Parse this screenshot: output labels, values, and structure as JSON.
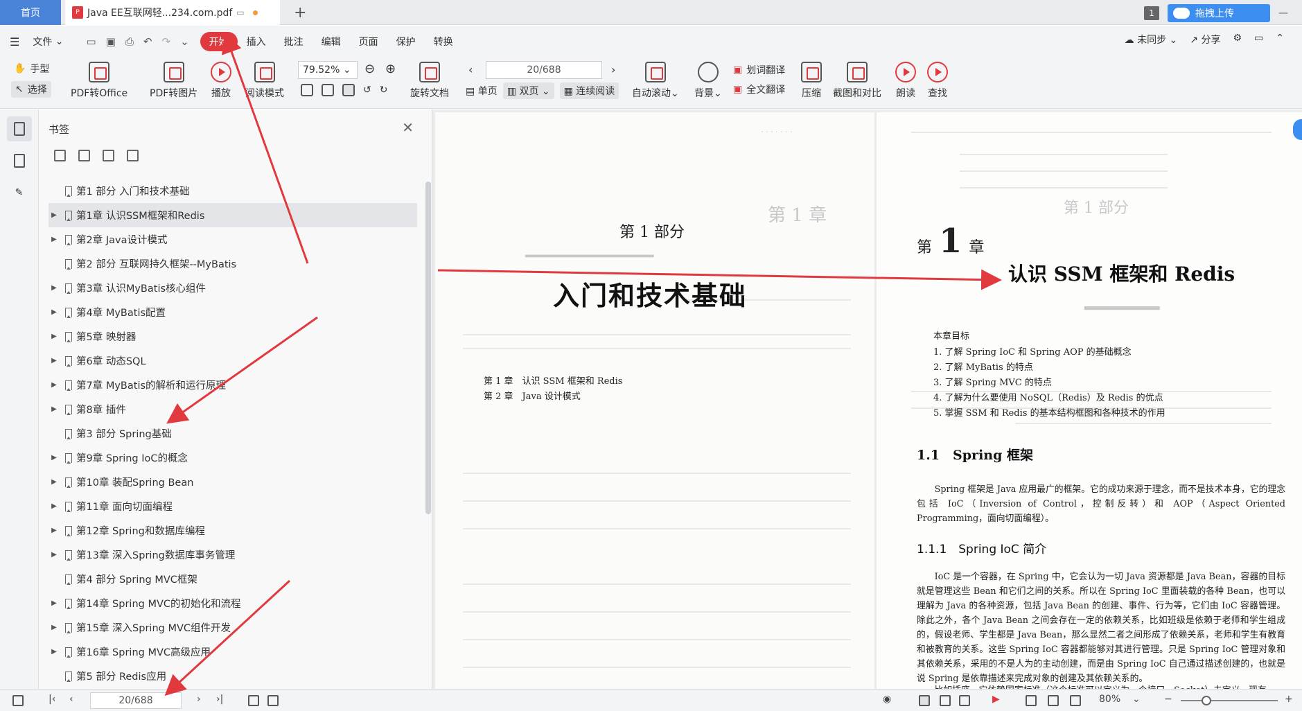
{
  "tabs": {
    "home": "首页",
    "document": "Java EE互联网轻...234.com.pdf",
    "badge": "1",
    "upload": "拖拽上传"
  },
  "menu": {
    "file": "文件",
    "items": [
      "开始",
      "插入",
      "批注",
      "编辑",
      "页面",
      "保护",
      "转换"
    ],
    "right": [
      "未同步",
      "分享"
    ]
  },
  "toolbar": {
    "hand": "手型",
    "select": "选择",
    "pdf_to_office": "PDF转Office",
    "pdf_to_image": "PDF转图片",
    "play": "播放",
    "read_mode": "阅读模式",
    "zoom": "79.52%",
    "page": "20/688",
    "rotate": "旋转文档",
    "single": "单页",
    "double": "双页",
    "continuous": "连续阅读",
    "autoscroll": "自动滚动",
    "background": "背景",
    "word_translate": "划词翻译",
    "full_translate": "全文翻译",
    "compress": "压缩",
    "screenshot": "截图和对比",
    "read_aloud": "朗读",
    "search": "查找"
  },
  "panel": {
    "title": "书签",
    "items": [
      {
        "label": "第1 部分 入门和技术基础",
        "arrow": false,
        "selected": false
      },
      {
        "label": "第1章 认识SSM框架和Redis",
        "arrow": true,
        "selected": true
      },
      {
        "label": "第2章 Java设计模式",
        "arrow": true,
        "selected": false
      },
      {
        "label": "第2 部分 互联网持久框架--MyBatis",
        "arrow": false,
        "selected": false
      },
      {
        "label": "第3章 认识MyBatis核心组件",
        "arrow": true,
        "selected": false
      },
      {
        "label": "第4章 MyBatis配置",
        "arrow": true,
        "selected": false
      },
      {
        "label": "第5章 映射器",
        "arrow": true,
        "selected": false
      },
      {
        "label": "第6章 动态SQL",
        "arrow": true,
        "selected": false
      },
      {
        "label": "第7章 MyBatis的解析和运行原理",
        "arrow": true,
        "selected": false
      },
      {
        "label": "第8章 插件",
        "arrow": true,
        "selected": false
      },
      {
        "label": "第3 部分 Spring基础",
        "arrow": false,
        "selected": false
      },
      {
        "label": "第9章 Spring IoC的概念",
        "arrow": true,
        "selected": false
      },
      {
        "label": "第10章 装配Spring Bean",
        "arrow": true,
        "selected": false
      },
      {
        "label": "第11章 面向切面编程",
        "arrow": true,
        "selected": false
      },
      {
        "label": "第12章 Spring和数据库编程",
        "arrow": true,
        "selected": false
      },
      {
        "label": "第13章 深入Spring数据库事务管理",
        "arrow": true,
        "selected": false
      },
      {
        "label": "第4 部分 Spring MVC框架",
        "arrow": false,
        "selected": false
      },
      {
        "label": "第14章 Spring MVC的初始化和流程",
        "arrow": true,
        "selected": false
      },
      {
        "label": "第15章 深入Spring MVC组件开发",
        "arrow": true,
        "selected": false
      },
      {
        "label": "第16章 Spring MVC高级应用",
        "arrow": true,
        "selected": false
      },
      {
        "label": "第5 部分 Redis应用",
        "arrow": false,
        "selected": false
      }
    ]
  },
  "left_page": {
    "part": "第 1 部分",
    "title": "入门和技术基础",
    "toc": [
      "第 1 章　认识 SSM 框架和 Redis",
      "第 2 章　Java 设计模式"
    ]
  },
  "right_page": {
    "chapter_prefix": "第",
    "chapter_number": "1",
    "chapter_suffix": "章",
    "title": "认识 SSM 框架和 Redis",
    "goal_heading": "本章目标",
    "goals": [
      "1. 了解 Spring IoC 和 Spring AOP 的基础概念",
      "2. 了解 MyBatis 的特点",
      "3. 了解 Spring MVC 的特点",
      "4. 了解为什么要使用 NoSQL（Redis）及 Redis 的优点",
      "5. 掌握 SSM 和 Redis 的基本结构框图和各种技术的作用"
    ],
    "section1": "1.1　Spring 框架",
    "para1": "Spring 框架是 Java 应用最广的框架。它的成功来源于理念，而不是技术本身，它的理念包括 IoC（Inversion of Control，控制反转）和 AOP（Aspect Oriented Programming，面向切面编程）。",
    "section2": "1.1.1　Spring IoC 简介",
    "para2": "IoC 是一个容器，在 Spring 中，它会认为一切 Java 资源都是 Java Bean，容器的目标就是管理这些 Bean 和它们之间的关系。所以在 Spring IoC 里面装载的各种 Bean，也可以理解为 Java 的各种资源，包括 Java Bean 的创建、事件、行为等，它们由 IoC 容器管理。除此之外，各个 Java Bean 之间会存在一定的依赖关系，比如班级是依赖于老师和学生组成的，假设老师、学生都是 Java Bean，那么显然二者之间形成了依赖关系，老师和学生有教育和被教育的关系。这些 Spring IoC 容器都能够对其进行管理。只是 Spring IoC 管理对象和其依赖关系，采用的不是人为的主动创建，而是由 Spring IoC 自己通过描述创建的，也就是说 Spring 是依靠描述来完成对象的创建及其依赖关系的。",
    "para3": "比如插座，它依赖国家标准（这个标准可以定义为一个接口，Socket）去定义，现有"
  },
  "status": {
    "page": "20/688",
    "zoom": "80%"
  },
  "colors": {
    "accent": "#e0393e",
    "tab_blue": "#4a84d8",
    "upload_blue": "#3c8ef0"
  }
}
